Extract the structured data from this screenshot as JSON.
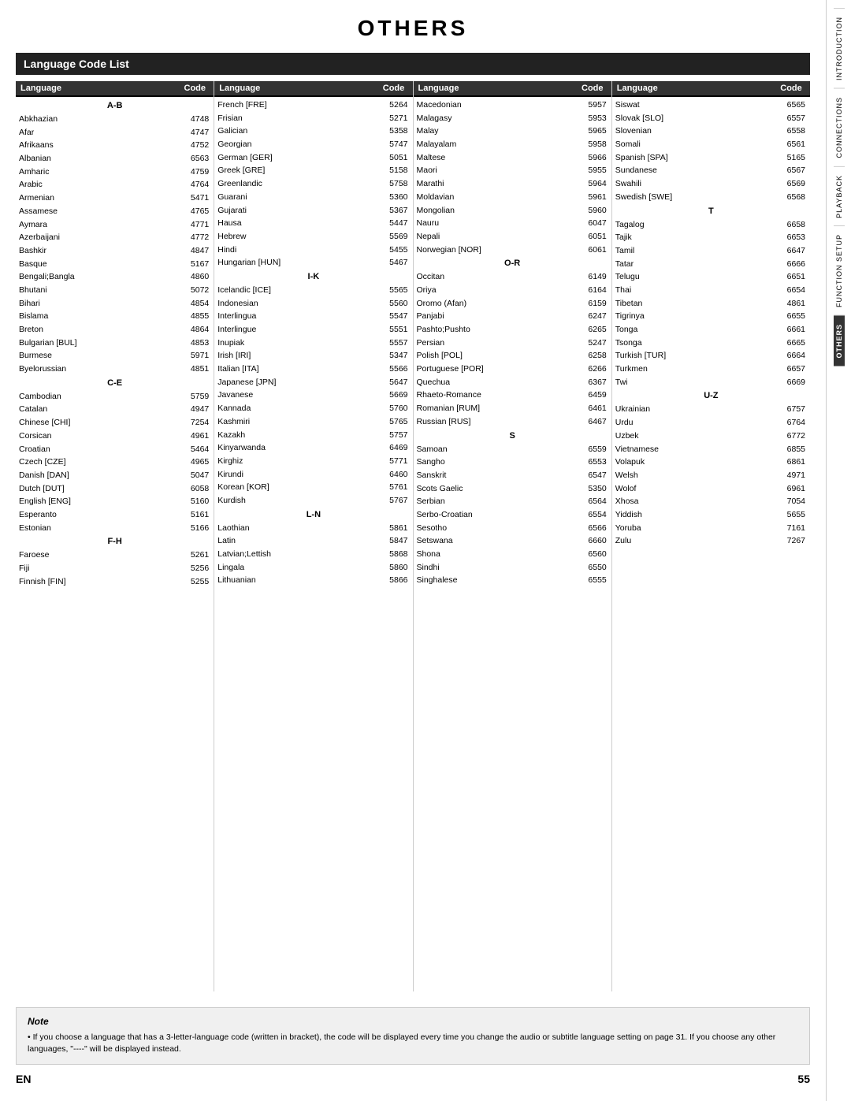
{
  "title": "OTHERS",
  "section": "Language Code List",
  "col_headers": [
    {
      "lang": "Language",
      "code": "Code"
    },
    {
      "lang": "Language",
      "code": "Code"
    },
    {
      "lang": "Language",
      "code": "Code"
    },
    {
      "lang": "Language",
      "code": "Code"
    }
  ],
  "columns": [
    {
      "sections": [
        {
          "label": "A-B",
          "entries": [
            {
              "name": "Abkhazian",
              "code": "4748"
            },
            {
              "name": "Afar",
              "code": "4747"
            },
            {
              "name": "Afrikaans",
              "code": "4752"
            },
            {
              "name": "Albanian",
              "code": "6563"
            },
            {
              "name": "Amharic",
              "code": "4759"
            },
            {
              "name": "Arabic",
              "code": "4764"
            },
            {
              "name": "Armenian",
              "code": "5471"
            },
            {
              "name": "Assamese",
              "code": "4765"
            },
            {
              "name": "Aymara",
              "code": "4771"
            },
            {
              "name": "Azerbaijani",
              "code": "4772"
            },
            {
              "name": "Bashkir",
              "code": "4847"
            },
            {
              "name": "Basque",
              "code": "5167"
            },
            {
              "name": "Bengali;Bangla",
              "code": "4860"
            },
            {
              "name": "Bhutani",
              "code": "5072"
            },
            {
              "name": "Bihari",
              "code": "4854"
            },
            {
              "name": "Bislama",
              "code": "4855"
            },
            {
              "name": "Breton",
              "code": "4864"
            },
            {
              "name": "Bulgarian [BUL]",
              "code": "4853"
            },
            {
              "name": "Burmese",
              "code": "5971"
            },
            {
              "name": "Byelorussian",
              "code": "4851"
            }
          ]
        },
        {
          "label": "C-E",
          "entries": [
            {
              "name": "Cambodian",
              "code": "5759"
            },
            {
              "name": "Catalan",
              "code": "4947"
            },
            {
              "name": "Chinese [CHI]",
              "code": "7254"
            },
            {
              "name": "Corsican",
              "code": "4961"
            },
            {
              "name": "Croatian",
              "code": "5464"
            },
            {
              "name": "Czech [CZE]",
              "code": "4965"
            },
            {
              "name": "Danish [DAN]",
              "code": "5047"
            },
            {
              "name": "Dutch [DUT]",
              "code": "6058"
            },
            {
              "name": "English [ENG]",
              "code": "5160"
            },
            {
              "name": "Esperanto",
              "code": "5161"
            },
            {
              "name": "Estonian",
              "code": "5166"
            }
          ]
        },
        {
          "label": "F-H",
          "entries": [
            {
              "name": "Faroese",
              "code": "5261"
            },
            {
              "name": "Fiji",
              "code": "5256"
            },
            {
              "name": "Finnish [FIN]",
              "code": "5255"
            }
          ]
        }
      ]
    },
    {
      "sections": [
        {
          "label": "",
          "entries": [
            {
              "name": "French [FRE]",
              "code": "5264"
            },
            {
              "name": "Frisian",
              "code": "5271"
            },
            {
              "name": "Galician",
              "code": "5358"
            },
            {
              "name": "Georgian",
              "code": "5747"
            },
            {
              "name": "German [GER]",
              "code": "5051"
            },
            {
              "name": "Greek [GRE]",
              "code": "5158"
            },
            {
              "name": "Greenlandic",
              "code": "5758"
            },
            {
              "name": "Guarani",
              "code": "5360"
            },
            {
              "name": "Gujarati",
              "code": "5367"
            },
            {
              "name": "Hausa",
              "code": "5447"
            },
            {
              "name": "Hebrew",
              "code": "5569"
            },
            {
              "name": "Hindi",
              "code": "5455"
            },
            {
              "name": "Hungarian [HUN]",
              "code": "5467"
            }
          ]
        },
        {
          "label": "I-K",
          "entries": [
            {
              "name": "Icelandic [ICE]",
              "code": "5565"
            },
            {
              "name": "Indonesian",
              "code": "5560"
            },
            {
              "name": "Interlingua",
              "code": "5547"
            },
            {
              "name": "Interlingue",
              "code": "5551"
            },
            {
              "name": "Inupiak",
              "code": "5557"
            },
            {
              "name": "Irish [IRI]",
              "code": "5347"
            },
            {
              "name": "Italian [ITA]",
              "code": "5566"
            },
            {
              "name": "Japanese [JPN]",
              "code": "5647"
            },
            {
              "name": "Javanese",
              "code": "5669"
            },
            {
              "name": "Kannada",
              "code": "5760"
            },
            {
              "name": "Kashmiri",
              "code": "5765"
            },
            {
              "name": "Kazakh",
              "code": "5757"
            },
            {
              "name": "Kinyarwanda",
              "code": "6469"
            },
            {
              "name": "Kirghiz",
              "code": "5771"
            },
            {
              "name": "Kirundi",
              "code": "6460"
            },
            {
              "name": "Korean [KOR]",
              "code": "5761"
            },
            {
              "name": "Kurdish",
              "code": "5767"
            }
          ]
        },
        {
          "label": "L-N",
          "entries": [
            {
              "name": "Laothian",
              "code": "5861"
            },
            {
              "name": "Latin",
              "code": "5847"
            },
            {
              "name": "Latvian;Lettish",
              "code": "5868"
            },
            {
              "name": "Lingala",
              "code": "5860"
            },
            {
              "name": "Lithuanian",
              "code": "5866"
            }
          ]
        }
      ]
    },
    {
      "sections": [
        {
          "label": "",
          "entries": [
            {
              "name": "Macedonian",
              "code": "5957"
            },
            {
              "name": "Malagasy",
              "code": "5953"
            },
            {
              "name": "Malay",
              "code": "5965"
            },
            {
              "name": "Malayalam",
              "code": "5958"
            },
            {
              "name": "Maltese",
              "code": "5966"
            },
            {
              "name": "Maori",
              "code": "5955"
            },
            {
              "name": "Marathi",
              "code": "5964"
            },
            {
              "name": "Moldavian",
              "code": "5961"
            },
            {
              "name": "Mongolian",
              "code": "5960"
            },
            {
              "name": "Nauru",
              "code": "6047"
            },
            {
              "name": "Nepali",
              "code": "6051"
            },
            {
              "name": "Norwegian [NOR]",
              "code": "6061"
            }
          ]
        },
        {
          "label": "O-R",
          "entries": [
            {
              "name": "Occitan",
              "code": "6149"
            },
            {
              "name": "Oriya",
              "code": "6164"
            },
            {
              "name": "Oromo (Afan)",
              "code": "6159"
            },
            {
              "name": "Panjabi",
              "code": "6247"
            },
            {
              "name": "Pashto;Pushto",
              "code": "6265"
            },
            {
              "name": "Persian",
              "code": "5247"
            },
            {
              "name": "Polish [POL]",
              "code": "6258"
            },
            {
              "name": "Portuguese [POR]",
              "code": "6266"
            },
            {
              "name": "Quechua",
              "code": "6367"
            },
            {
              "name": "Rhaeto-Romance",
              "code": "6459"
            },
            {
              "name": "Romanian [RUM]",
              "code": "6461"
            },
            {
              "name": "Russian [RUS]",
              "code": "6467"
            }
          ]
        },
        {
          "label": "S",
          "entries": [
            {
              "name": "Samoan",
              "code": "6559"
            },
            {
              "name": "Sangho",
              "code": "6553"
            },
            {
              "name": "Sanskrit",
              "code": "6547"
            },
            {
              "name": "Scots Gaelic",
              "code": "5350"
            },
            {
              "name": "Serbian",
              "code": "6564"
            },
            {
              "name": "Serbo-Croatian",
              "code": "6554"
            },
            {
              "name": "Sesotho",
              "code": "6566"
            },
            {
              "name": "Setswana",
              "code": "6660"
            },
            {
              "name": "Shona",
              "code": "6560"
            },
            {
              "name": "Sindhi",
              "code": "6550"
            },
            {
              "name": "Singhalese",
              "code": "6555"
            }
          ]
        }
      ]
    },
    {
      "sections": [
        {
          "label": "",
          "entries": [
            {
              "name": "Siswat",
              "code": "6565"
            },
            {
              "name": "Slovak [SLO]",
              "code": "6557"
            },
            {
              "name": "Slovenian",
              "code": "6558"
            },
            {
              "name": "Somali",
              "code": "6561"
            },
            {
              "name": "Spanish [SPA]",
              "code": "5165"
            },
            {
              "name": "Sundanese",
              "code": "6567"
            },
            {
              "name": "Swahili",
              "code": "6569"
            },
            {
              "name": "Swedish [SWE]",
              "code": "6568"
            }
          ]
        },
        {
          "label": "T",
          "entries": [
            {
              "name": "Tagalog",
              "code": "6658"
            },
            {
              "name": "Tajik",
              "code": "6653"
            },
            {
              "name": "Tamil",
              "code": "6647"
            },
            {
              "name": "Tatar",
              "code": "6666"
            },
            {
              "name": "Telugu",
              "code": "6651"
            },
            {
              "name": "Thai",
              "code": "6654"
            },
            {
              "name": "Tibetan",
              "code": "4861"
            },
            {
              "name": "Tigrinya",
              "code": "6655"
            },
            {
              "name": "Tonga",
              "code": "6661"
            },
            {
              "name": "Tsonga",
              "code": "6665"
            },
            {
              "name": "Turkish [TUR]",
              "code": "6664"
            },
            {
              "name": "Turkmen",
              "code": "6657"
            },
            {
              "name": "Twi",
              "code": "6669"
            }
          ]
        },
        {
          "label": "U-Z",
          "entries": [
            {
              "name": "Ukrainian",
              "code": "6757"
            },
            {
              "name": "Urdu",
              "code": "6764"
            },
            {
              "name": "Uzbek",
              "code": "6772"
            },
            {
              "name": "Vietnamese",
              "code": "6855"
            },
            {
              "name": "Volapuk",
              "code": "6861"
            },
            {
              "name": "Welsh",
              "code": "4971"
            },
            {
              "name": "Wolof",
              "code": "6961"
            },
            {
              "name": "Xhosa",
              "code": "7054"
            },
            {
              "name": "Yiddish",
              "code": "5655"
            },
            {
              "name": "Yoruba",
              "code": "7161"
            },
            {
              "name": "Zulu",
              "code": "7267"
            }
          ]
        }
      ]
    }
  ],
  "note": {
    "title": "Note",
    "text": "• If you choose a language that has a 3-letter-language code (written in bracket), the code will be displayed every time you change the audio or subtitle language setting on page 31. If you choose any other languages, \"----\" will be displayed instead."
  },
  "footer": {
    "en": "EN",
    "page": "55"
  },
  "sidebar_tabs": [
    {
      "label": "INTRODUCTION",
      "active": false
    },
    {
      "label": "CONNECTIONS",
      "active": false
    },
    {
      "label": "PLAYBACK",
      "active": false
    },
    {
      "label": "FUNCTION SETUP",
      "active": false
    },
    {
      "label": "OTHERS",
      "active": true
    }
  ]
}
